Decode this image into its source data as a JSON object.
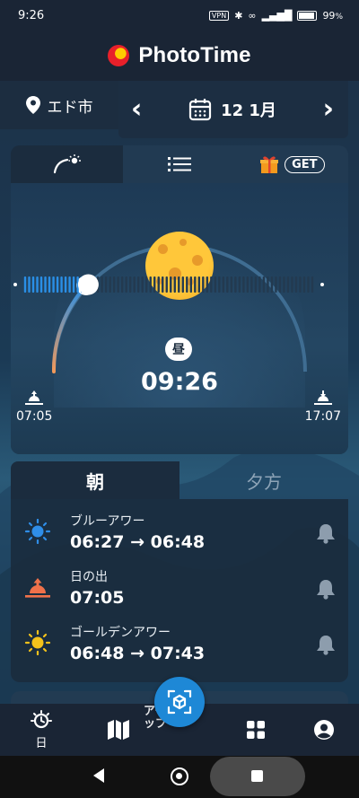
{
  "status": {
    "time": "9:26",
    "vpn": "VPN",
    "battery": "99"
  },
  "app": {
    "title": "PhotoTime"
  },
  "location": {
    "name": "エド市"
  },
  "date": {
    "label": "12 1月"
  },
  "tabs": {
    "get": "GET"
  },
  "arc": {
    "badge": "昼",
    "current_time": "09:26",
    "sunrise": "07:05",
    "sunset": "17:07",
    "progress": 0.22
  },
  "period_tabs": {
    "morning": "朝",
    "evening": "夕方"
  },
  "events": [
    {
      "label": "ブルーアワー",
      "time": "06:27 → 06:48",
      "icon": "blue-sun-icon",
      "color": "#2f8ee8"
    },
    {
      "label": "日の出",
      "time": "07:05",
      "icon": "sunrise-icon",
      "color": "#f0714a"
    },
    {
      "label": "ゴールデンアワー",
      "time": "06:48 → 07:43",
      "icon": "golden-sun-icon",
      "color": "#f3c21b"
    }
  ],
  "nav": {
    "day": "日",
    "ar": "アーブ\nップ"
  },
  "colors": {
    "accent": "#1e88d6",
    "arc_orange": "#f2995a",
    "arc_blue": "#2a8fe6"
  }
}
